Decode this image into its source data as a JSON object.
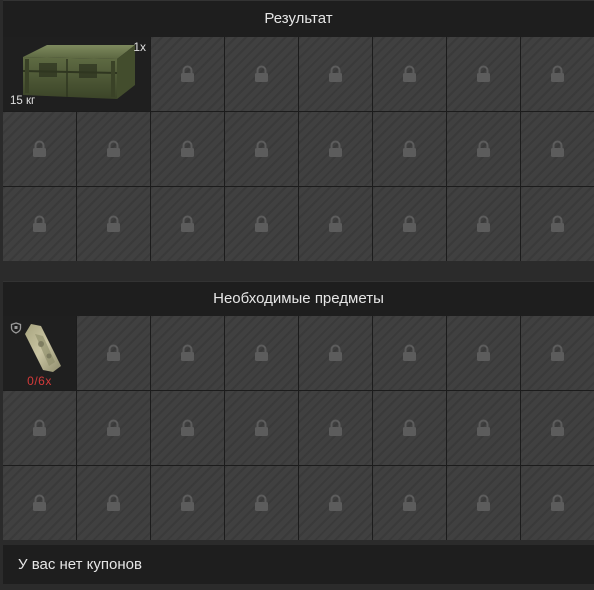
{
  "result_section": {
    "title": "Результат",
    "item": {
      "name": "ammo-crate",
      "quantity": "1x",
      "weight": "15 кг"
    },
    "locked_slots": 22
  },
  "required_section": {
    "title": "Необходимые предметы",
    "item": {
      "name": "fabric-item",
      "count": "0/6x",
      "count_color": "#d43a3a"
    },
    "locked_slots": 23
  },
  "coupon_bar": {
    "text": "У вас нет купонов"
  }
}
